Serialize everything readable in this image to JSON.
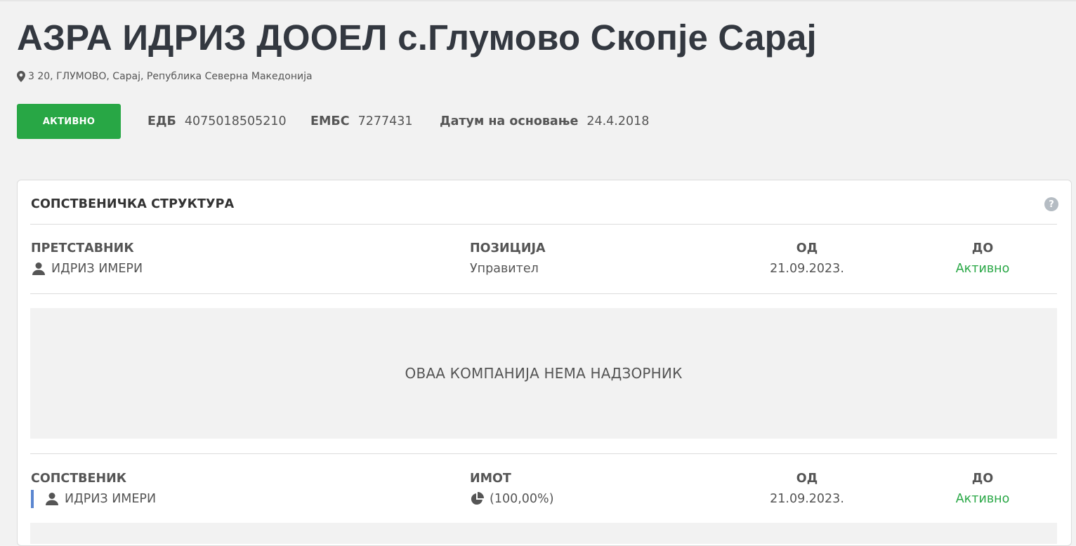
{
  "company": {
    "name": "АЗРА ИДРИЗ ДООЕЛ с.Глумово Скопје Сарај",
    "address": "3 20, ГЛУМОВО, Сарај, Република Северна Македонија",
    "status": "АКТИВНО",
    "edb_label": "ЕДБ",
    "edb_value": "4075018505210",
    "embs_label": "ЕМБС",
    "embs_value": "7277431",
    "founded_label": "Датум на основање",
    "founded_value": "24.4.2018"
  },
  "ownership": {
    "title": "СОПСТВЕНИЧКА СТРУКТУРА",
    "help_icon": "question-icon",
    "representatives": {
      "headers": {
        "name": "ПРЕТСТАВНИК",
        "position": "ПОЗИЦИЈА",
        "from": "ОД",
        "to": "ДО"
      },
      "rows": [
        {
          "name": "ИДРИЗ ИМЕРИ",
          "position": "Управител",
          "from": "21.09.2023.",
          "to": "Активно"
        }
      ]
    },
    "supervisor_empty": "ОВАА КОМПАНИЈА НЕМА НАДЗОРНИК",
    "owners": {
      "headers": {
        "name": "СОПСТВЕНИК",
        "share": "ИМОТ",
        "from": "ОД",
        "to": "ДО"
      },
      "rows": [
        {
          "name": "ИДРИЗ ИМЕРИ",
          "share": "(100,00%)",
          "from": "21.09.2023.",
          "to": "Активно"
        }
      ]
    }
  },
  "colors": {
    "active": "#28a745",
    "owner_bar": "#5b86d0",
    "title": "#333840"
  }
}
